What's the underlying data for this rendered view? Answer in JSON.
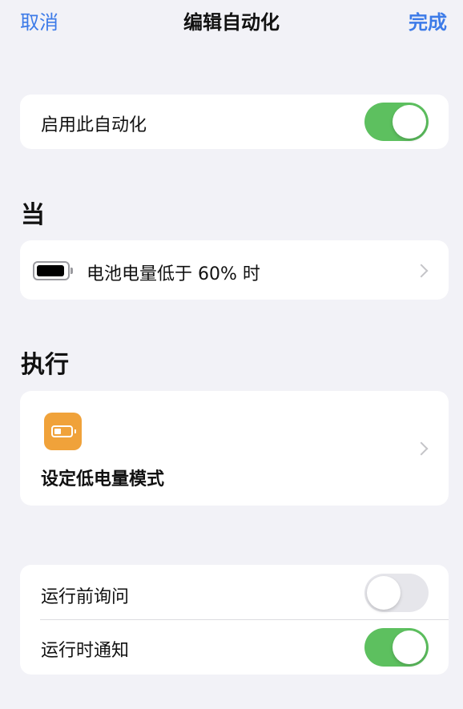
{
  "nav": {
    "cancel_label": "取消",
    "title": "编辑自动化",
    "done_label": "完成"
  },
  "enable_card": {
    "label": "启用此自动化",
    "toggle_on": true
  },
  "when_section": {
    "header": "当",
    "trigger_icon": "battery-icon",
    "trigger_label": "电池电量低于 60% 时"
  },
  "do_section": {
    "header": "执行",
    "action_icon": "low-power-mode-icon",
    "action_label": "设定低电量模式"
  },
  "options": {
    "ask_before_running": {
      "label": "运行前询问",
      "toggle_on": false
    },
    "notify_when_run": {
      "label": "运行时通知",
      "toggle_on": true
    }
  },
  "colors": {
    "accent": "#3d7be8",
    "toggle_on": "#5dc05f",
    "toggle_off": "#e6e6eb",
    "app_icon": "#f0a23a",
    "background": "#f2f2f7"
  }
}
